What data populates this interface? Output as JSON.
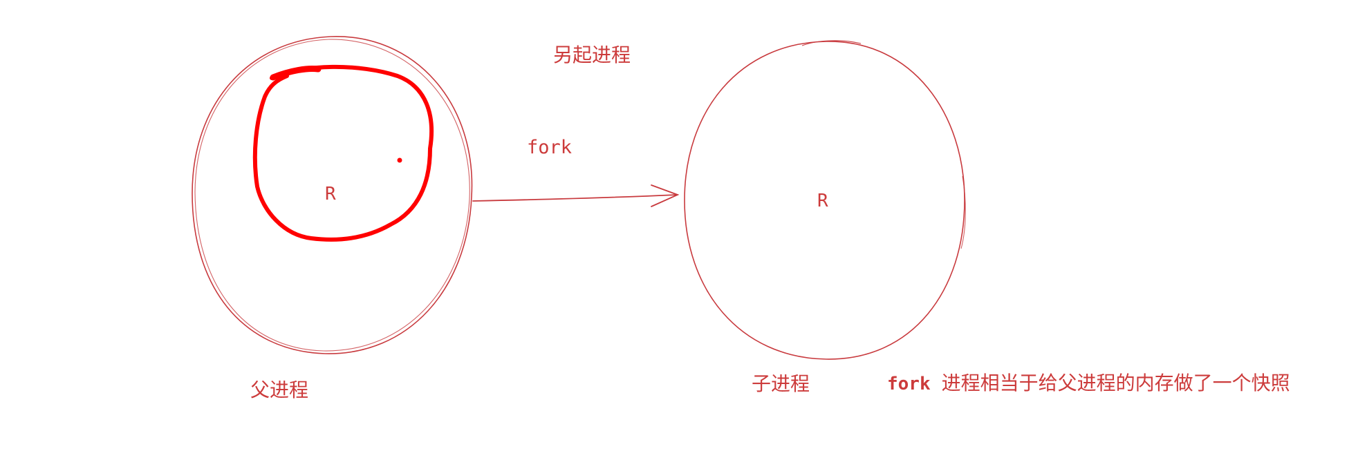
{
  "colors": {
    "stroke": "#c8393d",
    "highlight": "#ff0000",
    "text": "#cc3b3b"
  },
  "labels": {
    "spawn_process": "另起进程",
    "fork": "fork",
    "parent_r": "R",
    "child_r": "R",
    "parent_process": "父进程",
    "child_process": "子进程",
    "note_keyword": "fork",
    "note_text": "进程相当于给父进程的内存做了一个快照"
  }
}
